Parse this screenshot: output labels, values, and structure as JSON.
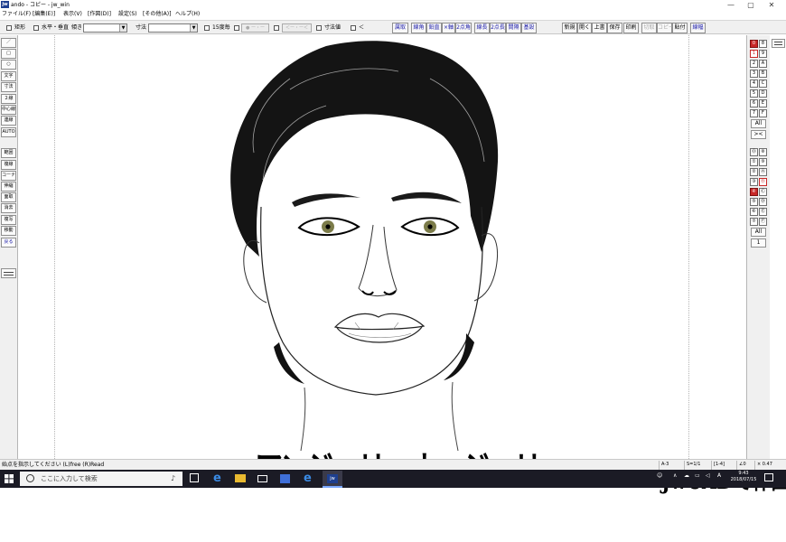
{
  "window": {
    "title": "ando - コピー - jw_win",
    "app_icon_text": "jw",
    "controls": [
      "—",
      "▢",
      "✕"
    ]
  },
  "menu": [
    "ファイル(F)",
    "[編集(E)]",
    "表示(V)",
    "[作図(D)]",
    "設定(S)",
    "[その他(A)]",
    "ヘルプ(H)"
  ],
  "toolbar": {
    "rect_label": "矩形",
    "horiz_vert_label": "水平・垂直",
    "tilt_label": "傾き",
    "dimension_label": "寸法",
    "deg15_label": "15度毎",
    "dim_value_label": "寸法値",
    "arrow_label": "＜",
    "dim_combo_1": "● ー・ー",
    "dim_combo_2": "＜ー・ー＜",
    "buttons_mid": [
      "属取",
      "線角",
      "鉛直",
      "×軸",
      "2点角",
      "線長",
      "2点長",
      "間隔",
      "基設"
    ],
    "buttons_right": [
      "新規",
      "開く",
      "上書",
      "保存",
      "印刷",
      "切取",
      "コピー",
      "貼付",
      "線幅"
    ]
  },
  "left_tools": [
    "／",
    "□",
    "○",
    "文字",
    "寸法",
    "２線",
    "中心線",
    "連線",
    "AUTO",
    "範囲",
    "複線",
    "コーナー",
    "伸縮",
    "面取",
    "消去",
    "複写",
    "移動",
    "戻る"
  ],
  "layers_group": {
    "col1": [
      "0",
      "1",
      "2",
      "3",
      "4",
      "5",
      "6",
      "7"
    ],
    "col2": [
      "8",
      "9",
      "A",
      "B",
      "C",
      "D",
      "E",
      "F"
    ],
    "all_label": "All",
    "swap_label": "><"
  },
  "layers": {
    "col1": [
      "⓪",
      "①",
      "②",
      "③",
      "④",
      "⑤",
      "⑥",
      "⑦"
    ],
    "col2": [
      "⑧",
      "⑨",
      "Ⓐ",
      "Ⓑ",
      "Ⓒ",
      "Ⓓ",
      "Ⓔ",
      "Ⓕ"
    ],
    "all_label": "All",
    "one_label": "1"
  },
  "status": {
    "message": "始点を指示してください (L)free (R)Read",
    "paper": "A-3",
    "scale": "S=1/1",
    "layer": "[1-4]",
    "angle": "∠0",
    "zoom": "× 0.47"
  },
  "drawing": {
    "caption_name": "アンジェリーナ・ジョリー",
    "caption_tool": "JwCADで作図"
  },
  "taskbar": {
    "search_placeholder": "ここに入力して検索",
    "time": "9:43",
    "date": "2018/07/15",
    "ime": "A"
  }
}
